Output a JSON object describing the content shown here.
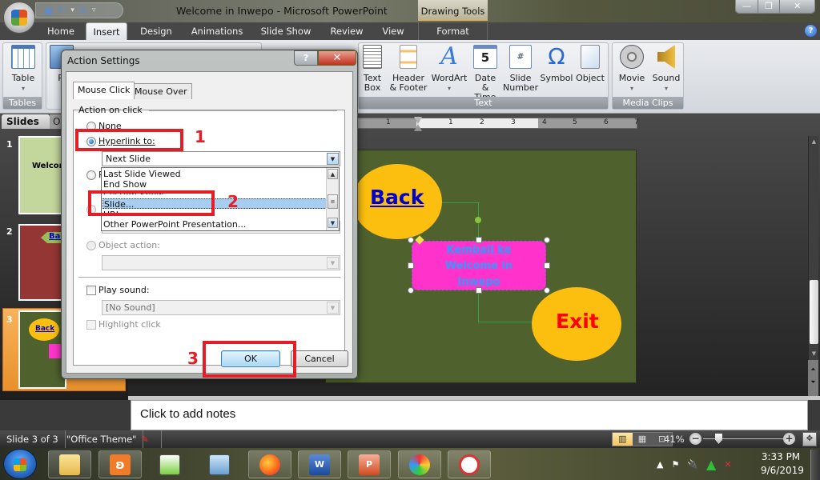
{
  "window": {
    "title": "Welcome in Inwepo - Microsoft PowerPoint",
    "contextual_tab_group": "Drawing Tools",
    "controls": {
      "minimize": "—",
      "restore": "❐",
      "close": "✕"
    },
    "help_icon": "?"
  },
  "quick_access": {
    "save": "save-icon",
    "undo": "undo-icon",
    "redo": "redo-icon",
    "customize": "▿"
  },
  "ribbon_tabs": [
    {
      "label": "Home",
      "active": false
    },
    {
      "label": "Insert",
      "active": true
    },
    {
      "label": "Design",
      "active": false
    },
    {
      "label": "Animations",
      "active": false
    },
    {
      "label": "Slide Show",
      "active": false
    },
    {
      "label": "Review",
      "active": false
    },
    {
      "label": "View",
      "active": false
    },
    {
      "label": "Format",
      "active": false
    }
  ],
  "ribbon": {
    "groups": {
      "tables": "Tables",
      "text": "Text",
      "media": "Media Clips"
    },
    "buttons": {
      "table": "Table",
      "picture": "Pi",
      "text_box_1": "Text",
      "text_box_2": "Box",
      "header_1": "Header",
      "header_2": "& Footer",
      "wordart": "WordArt",
      "date_1": "Date",
      "date_2": "& Time",
      "slide_num_1": "Slide",
      "slide_num_2": "Number",
      "symbol": "Symbol",
      "object": "Object",
      "movie": "Movie",
      "sound": "Sound"
    }
  },
  "slides_pane": {
    "tabs": [
      "Slides",
      "O"
    ],
    "slides": [
      {
        "number": "1",
        "text": "Welcom",
        "bg": "#c3d69b"
      },
      {
        "number": "2",
        "text": "Bac",
        "bg": "#943634"
      },
      {
        "number": "3",
        "text": "Back",
        "bg": "#4f612d",
        "selected": true
      }
    ]
  },
  "ruler": {
    "labels": [
      "1",
      "1",
      "2",
      "3",
      "4",
      "5",
      "6",
      "7"
    ]
  },
  "slide": {
    "back_label": "Back",
    "exit_label": "Exit",
    "center_text": [
      "Kembali ke",
      "Welcome in",
      "Inwepo"
    ],
    "colors": {
      "background": "#4f612d",
      "ellipse": "#fcbf0f",
      "rect": "#ff33cc",
      "link_text": "#0000cc",
      "exit_text": "#ff0000",
      "center_text": "#3399ff"
    }
  },
  "notes": {
    "placeholder": "Click to add notes"
  },
  "status_bar": {
    "slide_info": "Slide 3 of 3",
    "theme": "\"Office Theme\"",
    "zoom": "41%",
    "zoom_fraction": 0.41,
    "view_buttons": [
      "▥",
      "▦",
      "⊡"
    ]
  },
  "taskbar": {
    "apps": [
      "windows-explorer",
      "xampp",
      "notepad-plus-plus",
      "calculator",
      "firefox",
      "word",
      "powerpoint",
      "paint",
      "snipping-tool"
    ],
    "time": "3:33 PM",
    "date": "9/6/2019"
  },
  "dialog": {
    "title": "Action Settings",
    "help": "?",
    "close": "✕",
    "tabs": [
      "Mouse Click",
      "Mouse Over"
    ],
    "section_label": "Action on click",
    "options": {
      "none": "None",
      "hyperlink": "Hyperlink to:",
      "run_program": "R",
      "run_macro": "R",
      "object_action": "Object action:"
    },
    "hyperlink_value": "Next Slide",
    "hyperlink_options": [
      "Last Slide Viewed",
      "End Show",
      "Custom Show...",
      "Slide...",
      "URL",
      "Other PowerPoint Presentation..."
    ],
    "hyperlink_highlighted": "Slide...",
    "play_sound_label": "Play sound:",
    "sound_value": "[No Sound]",
    "highlight_click_label": "Highlight click",
    "ok": "OK",
    "cancel": "Cancel"
  },
  "annotations": {
    "step1": "1",
    "step2": "2",
    "step3": "3",
    "color": "#e21f27"
  }
}
